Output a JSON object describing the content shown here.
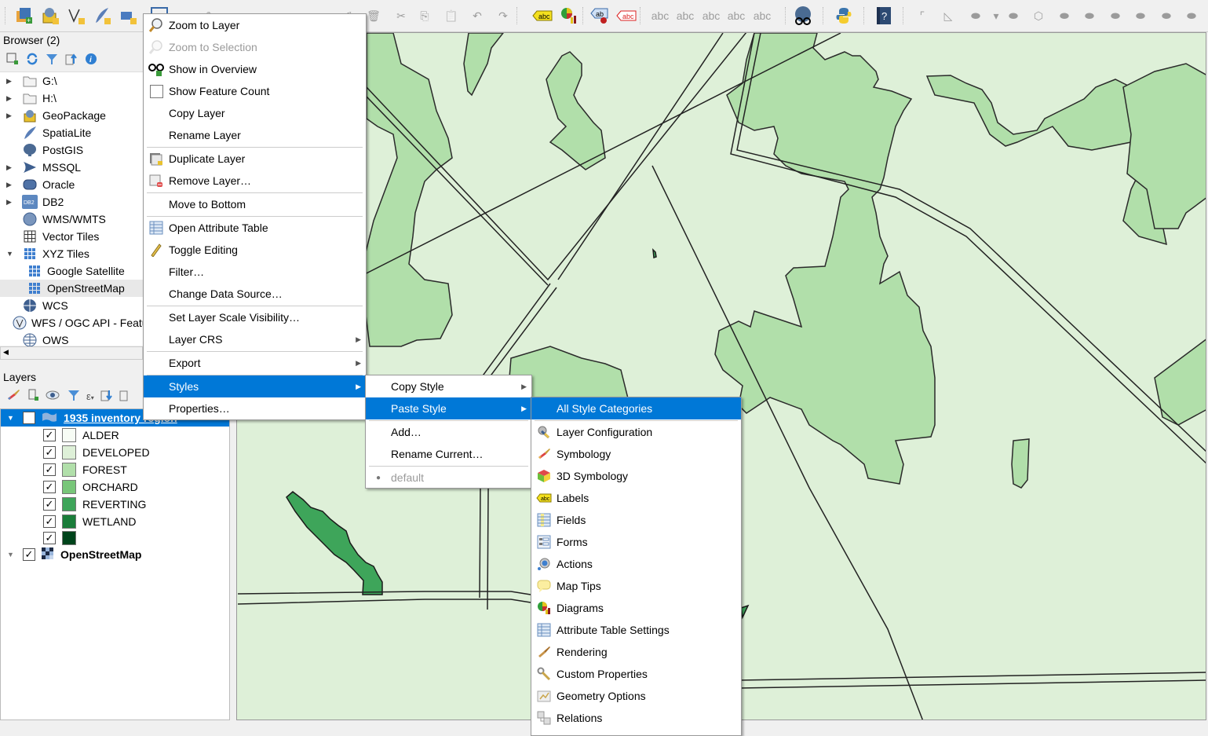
{
  "toolbar": {
    "icons": [
      "new-layer-icon",
      "new-geopackage-icon",
      "new-shapefile-icon",
      "new-spatialite-icon",
      "new-temporary-layer-icon",
      "new-virtual-layer-icon",
      "digitize-icon",
      "toggle-editing-icon",
      "save-edits-icon",
      "add-feature-icon",
      "vertex-tool-icon",
      "delete-icon",
      "cut-icon",
      "copy-icon",
      "paste-icon",
      "undo-icon",
      "redo-icon",
      "label-icon",
      "diagram-icon",
      "pin-label-icon",
      "highlight-label-icon",
      "python-icon",
      "help-icon"
    ]
  },
  "browser": {
    "title": "Browser (2)",
    "items": [
      {
        "label": "G:\\",
        "icon": "folder-icon",
        "expand": "collapsed"
      },
      {
        "label": "H:\\",
        "icon": "folder-icon",
        "expand": "collapsed"
      },
      {
        "label": "GeoPackage",
        "icon": "geopackage-icon",
        "expand": "collapsed"
      },
      {
        "label": "SpatiaLite",
        "icon": "spatialite-icon",
        "expand": "none"
      },
      {
        "label": "PostGIS",
        "icon": "postgis-icon",
        "expand": "none"
      },
      {
        "label": "MSSQL",
        "icon": "mssql-icon",
        "expand": "collapsed"
      },
      {
        "label": "Oracle",
        "icon": "oracle-icon",
        "expand": "collapsed"
      },
      {
        "label": "DB2",
        "icon": "db2-icon",
        "expand": "collapsed"
      },
      {
        "label": "WMS/WMTS",
        "icon": "wms-icon",
        "expand": "none"
      },
      {
        "label": "Vector Tiles",
        "icon": "vector-tiles-icon",
        "expand": "none"
      },
      {
        "label": "XYZ Tiles",
        "icon": "xyz-tiles-icon",
        "expand": "expanded"
      },
      {
        "label": "Google Satellite",
        "icon": "xyz-tiles-icon",
        "expand": "child"
      },
      {
        "label": "OpenStreetMap",
        "icon": "xyz-tiles-icon",
        "expand": "child"
      },
      {
        "label": "WCS",
        "icon": "wcs-icon",
        "expand": "none"
      },
      {
        "label": "WFS / OGC API - Features",
        "icon": "wfs-icon",
        "expand": "none"
      },
      {
        "label": "OWS",
        "icon": "ows-icon",
        "expand": "none"
      }
    ]
  },
  "layers": {
    "title": "Layers",
    "group_layer": "1935 inventory region",
    "categories": [
      {
        "label": "ALDER",
        "color": "#f7fcf5"
      },
      {
        "label": "DEVELOPED",
        "color": "#def0d8"
      },
      {
        "label": "FOREST",
        "color": "#b1dfaa"
      },
      {
        "label": "ORCHARD",
        "color": "#78c679"
      },
      {
        "label": "REVERTING",
        "color": "#3ea55a"
      },
      {
        "label": "WETLAND",
        "color": "#1a7d3a"
      },
      {
        "label": "",
        "color": "#00441b"
      }
    ],
    "basemap": "OpenStreetMap"
  },
  "context_menu": {
    "items": [
      {
        "label": "Zoom to Layer",
        "u": "Z",
        "icon": "zoom-to-layer-icon"
      },
      {
        "label": "Zoom to Selection",
        "u": "Z",
        "icon": "zoom-to-selection-icon",
        "disabled": true
      },
      {
        "label": "Show in Overview",
        "u": "S",
        "icon": "show-in-overview-icon"
      },
      {
        "label": "Show Feature Count",
        "icon": "checkbox-icon"
      },
      {
        "label": "Copy Layer"
      },
      {
        "label": "Rename Layer"
      },
      {
        "label": "Duplicate Layer",
        "u": "D",
        "icon": "duplicate-layer-icon"
      },
      {
        "label": "Remove Layer…",
        "u": "R",
        "icon": "remove-layer-icon"
      },
      {
        "label": "Move to Bottom"
      },
      {
        "label": "Open Attribute Table",
        "u": "O",
        "icon": "attribute-table-icon"
      },
      {
        "label": "Toggle Editing",
        "icon": "pencil-icon"
      },
      {
        "label": "Filter…"
      },
      {
        "label": "Change Data Source…"
      },
      {
        "label": "Set Layer Scale Visibility…"
      },
      {
        "label": "Layer CRS"
      },
      {
        "label": "Export"
      },
      {
        "label": "Styles"
      },
      {
        "label": "Properties…"
      }
    ]
  },
  "styles_menu": {
    "items": [
      {
        "label": "Copy Style"
      },
      {
        "label": "Paste Style"
      },
      {
        "label": "Add…"
      },
      {
        "label": "Rename Current…"
      },
      {
        "label": "default"
      }
    ]
  },
  "paste_menu": {
    "items": [
      {
        "label": "All Style Categories"
      },
      {
        "label": "Layer Configuration",
        "icon": "layer-configuration-icon"
      },
      {
        "label": "Symbology",
        "icon": "symbology-icon"
      },
      {
        "label": "3D Symbology",
        "icon": "3d-symbology-icon"
      },
      {
        "label": "Labels",
        "icon": "labels-icon"
      },
      {
        "label": "Fields",
        "icon": "fields-icon"
      },
      {
        "label": "Forms",
        "icon": "forms-icon"
      },
      {
        "label": "Actions",
        "icon": "actions-icon"
      },
      {
        "label": "Map Tips",
        "icon": "map-tips-icon"
      },
      {
        "label": "Diagrams",
        "icon": "diagrams-icon"
      },
      {
        "label": "Attribute Table Settings",
        "icon": "attribute-table-settings-icon"
      },
      {
        "label": "Rendering",
        "icon": "rendering-icon"
      },
      {
        "label": "Custom Properties",
        "icon": "custom-properties-icon"
      },
      {
        "label": "Geometry Options",
        "icon": "geometry-options-icon"
      },
      {
        "label": "Relations",
        "icon": "relations-icon"
      }
    ]
  },
  "colors": {
    "highlight": "#0078d7",
    "map_background": "#def0d8",
    "forest": "#b1dfaa",
    "reverting": "#3ea55a"
  }
}
